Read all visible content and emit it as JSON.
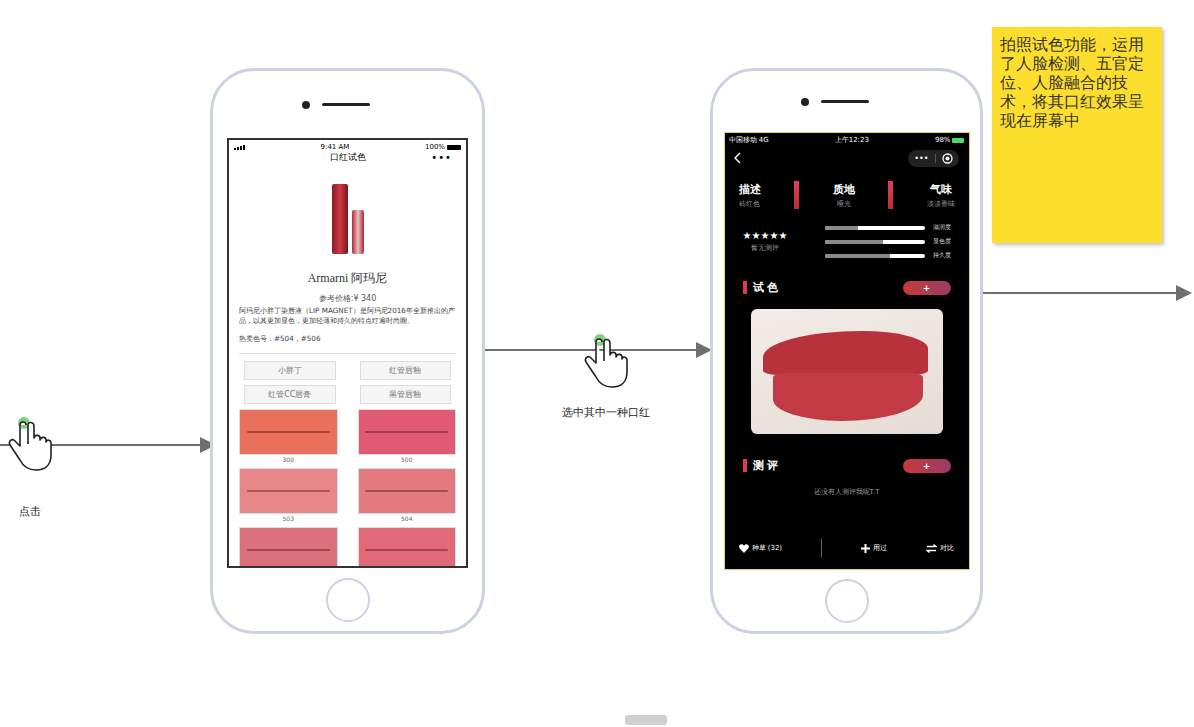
{
  "steps": [
    {
      "label": "点击"
    },
    {
      "label": "选中其中一种口红"
    }
  ],
  "screen1": {
    "status": {
      "time": "9:41 AM",
      "battery": "100%"
    },
    "title": "口红试色",
    "menu": "•••",
    "brand": "Armarni 阿玛尼",
    "price": "参考价格:¥ 340",
    "description": "阿玛尼小胖丁染唇液（LIP MAGNET）是阿玛尼2016年全新推出的产品，以其更加显色，更加轻薄和持久的特点红遍时尚圈。",
    "hot": "热卖色号：#504，#506",
    "lines": [
      {
        "label": "小胖丁"
      },
      {
        "label": "红管唇釉"
      },
      {
        "label": "红管CC唇膏"
      },
      {
        "label": "黑管唇釉"
      }
    ],
    "swatches": [
      {
        "label": "300",
        "color": "#e8705c"
      },
      {
        "label": "500",
        "color": "#e05a74"
      },
      {
        "label": "503",
        "color": "#e8878a"
      },
      {
        "label": "504",
        "color": "#e27a80"
      },
      {
        "label": "",
        "color": "#d9707a"
      },
      {
        "label": "",
        "color": "#e06a78"
      }
    ]
  },
  "screen2": {
    "status": {
      "carrier": "中国移动  4G",
      "time": "上午12:23",
      "battery": "98%"
    },
    "menu": "•••",
    "attributes": [
      {
        "title": "描述",
        "value": "砖红色"
      },
      {
        "title": "质地",
        "value": "哑光"
      },
      {
        "title": "气味",
        "value": "淡淡香味"
      }
    ],
    "rating": {
      "stars": 5,
      "label": "暂无测评"
    },
    "metrics": [
      {
        "label": "滋润度",
        "level": 0.33
      },
      {
        "label": "显色度",
        "level": 0.58
      },
      {
        "label": "持久度",
        "level": 0.65
      }
    ],
    "tryon": {
      "title": "试 色",
      "add": "+"
    },
    "review": {
      "title": "测 评",
      "add": "+",
      "empty": "还没有人测评我呢T.T"
    },
    "actions": [
      {
        "label": "种草 (32)",
        "kind": "heart"
      },
      {
        "label": "用过",
        "kind": "plus"
      },
      {
        "label": "对比",
        "kind": "swap"
      }
    ]
  },
  "note": {
    "text": "拍照试色功能，运用了人脸检测、五官定位、人脸融合的技术，将其口红效果呈现在屏幕中"
  }
}
